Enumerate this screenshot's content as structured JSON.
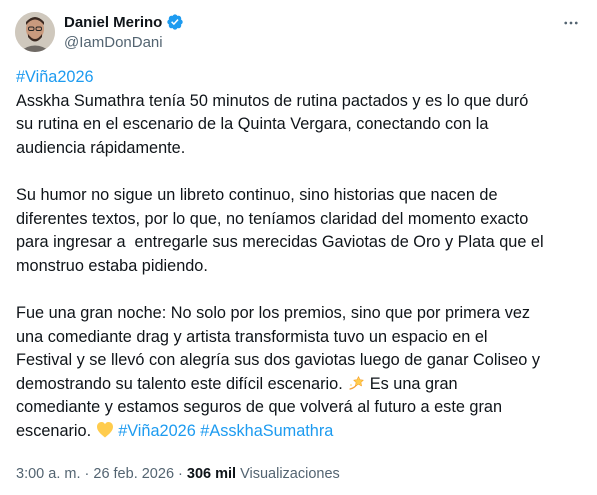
{
  "author": {
    "name": "Daniel Merino",
    "handle": "@IamDonDani",
    "verified": true
  },
  "post": {
    "hashtag_top": "#Viña2026",
    "p1": [
      "Asskha Sumathra tenía 50 minutos de rutina pactados y es lo que duró",
      "su rutina en el escenario de la Quinta Vergara, conectando con la",
      "audiencia rápidamente."
    ],
    "p2": [
      "Su humor no sigue un libreto continuo, sino historias que nacen de",
      "diferentes textos, por lo que, no teníamos claridad del momento exacto",
      "para ingresar a  entregarle sus merecidas Gaviotas de Oro y Plata que el",
      "monstruo estaba pidiendo."
    ],
    "p3": [
      "Fue una gran noche: No solo por los premios, sino que por primera vez",
      "una comediante drag y artista transformista tuvo un espacio en el",
      "Festival y se llevó con alegría sus dos gaviotas luego de ganar Coliseo y",
      "demostrando su talento este difícil escenario. ",
      " Es una gran",
      "comediante y estamos seguros de que volverá al futuro a este gran",
      "escenario. "
    ],
    "hashtags_end": [
      "#Viña2026",
      "#AsskhaSumathra"
    ],
    "emojis": [
      "dizzy-star-emoji",
      "yellow-heart-emoji"
    ]
  },
  "meta": {
    "time": "3:00 a. m.",
    "separator": " · ",
    "date": "26 feb. 2026",
    "views_count": "306 mil",
    "views_label": " Visualizaciones"
  },
  "colors": {
    "link": "#1d9bf0",
    "text": "#0f1419",
    "secondary": "#536471",
    "verified": "#1d9bf0"
  }
}
